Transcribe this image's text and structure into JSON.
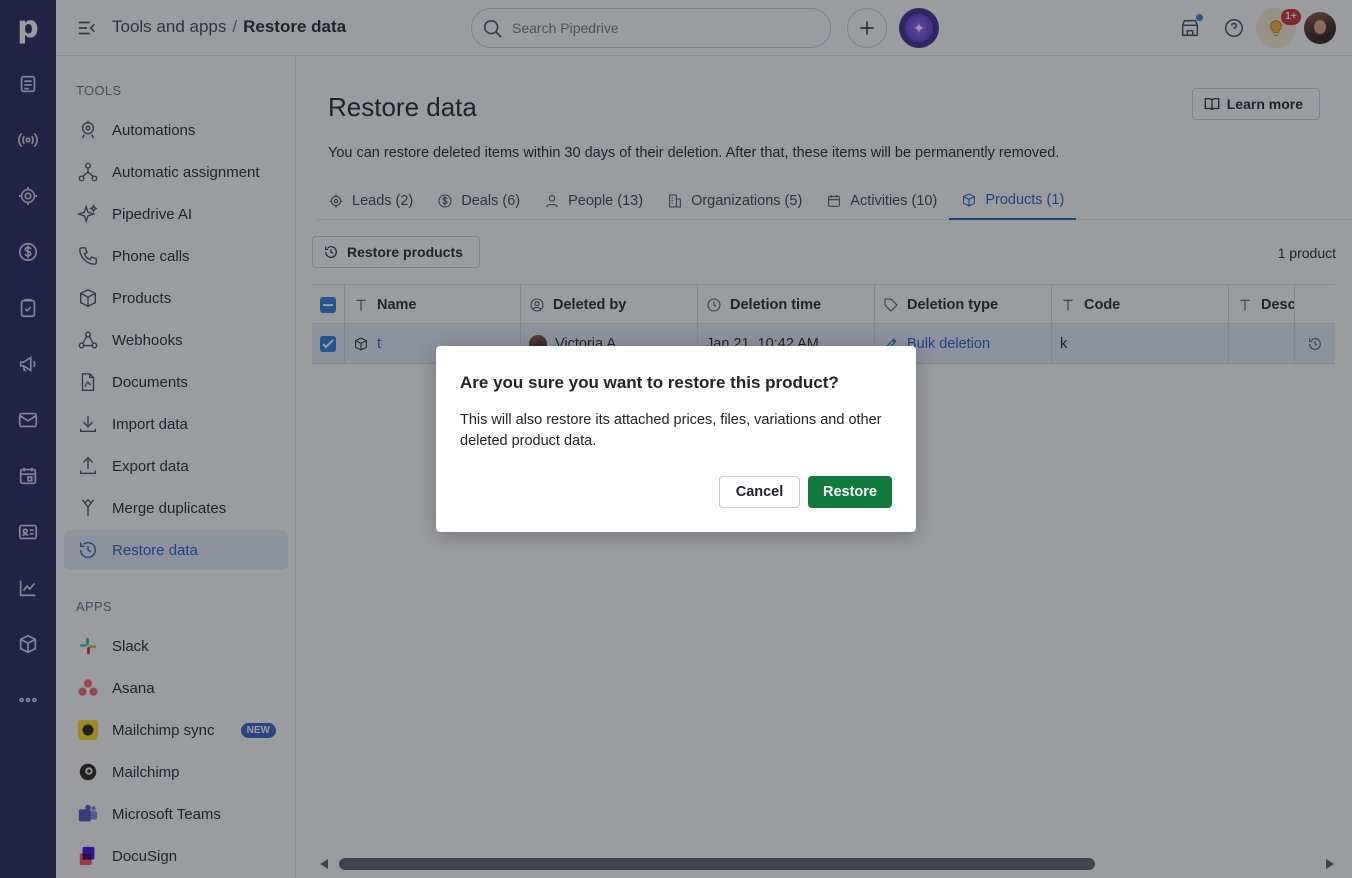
{
  "topbar": {
    "breadcrumb_parent": "Tools and apps",
    "breadcrumb_sep": "/",
    "breadcrumb_current": "Restore data",
    "search_placeholder": "Search Pipedrive",
    "notification_count": "1+"
  },
  "rail": {
    "logo": "p",
    "items": [
      "leads-icon",
      "campaigns-radio-icon",
      "deals-target-icon",
      "deals-dollar-icon",
      "activities-clipboard-icon",
      "campaigns-megaphone-icon",
      "mail-icon",
      "calendar-icon",
      "contacts-card-icon",
      "insights-chart-icon",
      "products-box-icon",
      "more-dots-icon"
    ]
  },
  "sidenav": {
    "tools_title": "TOOLS",
    "tools": [
      {
        "label": "Automations",
        "icon": "automations-icon"
      },
      {
        "label": "Automatic assignment",
        "icon": "assignment-icon"
      },
      {
        "label": "Pipedrive AI",
        "icon": "sparkle-icon"
      },
      {
        "label": "Phone calls",
        "icon": "phone-icon"
      },
      {
        "label": "Products",
        "icon": "box-icon"
      },
      {
        "label": "Webhooks",
        "icon": "webhook-icon"
      },
      {
        "label": "Documents",
        "icon": "document-icon"
      },
      {
        "label": "Import data",
        "icon": "import-icon"
      },
      {
        "label": "Export data",
        "icon": "export-icon"
      },
      {
        "label": "Merge duplicates",
        "icon": "merge-icon"
      },
      {
        "label": "Restore data",
        "icon": "restore-icon"
      }
    ],
    "apps_title": "APPS",
    "apps": [
      {
        "label": "Slack",
        "icon": "slack-logo-icon"
      },
      {
        "label": "Asana",
        "icon": "asana-logo-icon"
      },
      {
        "label": "Mailchimp sync",
        "icon": "mailchimp-logo-icon",
        "tag": "NEW"
      },
      {
        "label": "Mailchimp",
        "icon": "mailchimp-mono-icon"
      },
      {
        "label": "Microsoft Teams",
        "icon": "teams-logo-icon"
      },
      {
        "label": "DocuSign",
        "icon": "docusign-logo-icon"
      }
    ]
  },
  "main": {
    "title": "Restore data",
    "learn_more": "Learn more",
    "description": "You can restore deleted items within 30 days of their deletion. After that, these items will be permanently removed.",
    "tabs": [
      {
        "label": "Leads (2)",
        "icon": "target-icon"
      },
      {
        "label": "Deals (6)",
        "icon": "dollar-icon"
      },
      {
        "label": "People (13)",
        "icon": "person-icon"
      },
      {
        "label": "Organizations (5)",
        "icon": "building-icon"
      },
      {
        "label": "Activities (10)",
        "icon": "calendar-icon"
      },
      {
        "label": "Products (1)",
        "icon": "box-icon"
      }
    ],
    "restore_button": "Restore products",
    "count": "1 product",
    "columns": [
      "Name",
      "Deleted by",
      "Deletion time",
      "Deletion type",
      "Code",
      "Desc"
    ],
    "row": {
      "name": "t",
      "deleted_by": "Victoria A",
      "deletion_time": "Jan 21, 10:42 AM",
      "deletion_type": "Bulk deletion",
      "code": "k",
      "description": ""
    }
  },
  "dialog": {
    "title": "Are you sure you want to restore this product?",
    "body": "This will also restore its attached prices, files, variations and other deleted product data.",
    "cancel": "Cancel",
    "confirm": "Restore"
  },
  "colors": {
    "rail": "#26265a",
    "accent": "#1a5fc2",
    "confirm": "#107a3a",
    "badge": "#d0282b"
  }
}
